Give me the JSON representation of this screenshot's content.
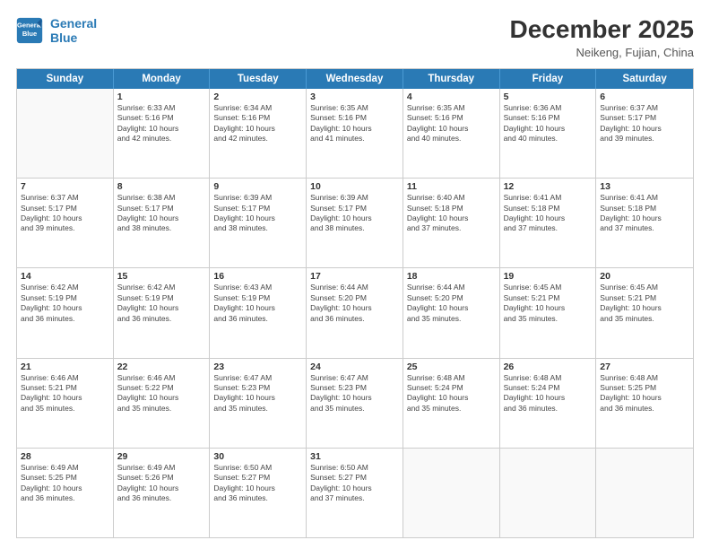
{
  "header": {
    "logo_line1": "General",
    "logo_line2": "Blue",
    "title": "December 2025",
    "subtitle": "Neikeng, Fujian, China"
  },
  "weekdays": [
    "Sunday",
    "Monday",
    "Tuesday",
    "Wednesday",
    "Thursday",
    "Friday",
    "Saturday"
  ],
  "rows": [
    [
      {
        "day": "",
        "sunrise": "",
        "sunset": "",
        "daylight": "",
        "daylight2": ""
      },
      {
        "day": "1",
        "sunrise": "Sunrise: 6:33 AM",
        "sunset": "Sunset: 5:16 PM",
        "daylight": "Daylight: 10 hours",
        "daylight2": "and 42 minutes."
      },
      {
        "day": "2",
        "sunrise": "Sunrise: 6:34 AM",
        "sunset": "Sunset: 5:16 PM",
        "daylight": "Daylight: 10 hours",
        "daylight2": "and 42 minutes."
      },
      {
        "day": "3",
        "sunrise": "Sunrise: 6:35 AM",
        "sunset": "Sunset: 5:16 PM",
        "daylight": "Daylight: 10 hours",
        "daylight2": "and 41 minutes."
      },
      {
        "day": "4",
        "sunrise": "Sunrise: 6:35 AM",
        "sunset": "Sunset: 5:16 PM",
        "daylight": "Daylight: 10 hours",
        "daylight2": "and 40 minutes."
      },
      {
        "day": "5",
        "sunrise": "Sunrise: 6:36 AM",
        "sunset": "Sunset: 5:16 PM",
        "daylight": "Daylight: 10 hours",
        "daylight2": "and 40 minutes."
      },
      {
        "day": "6",
        "sunrise": "Sunrise: 6:37 AM",
        "sunset": "Sunset: 5:17 PM",
        "daylight": "Daylight: 10 hours",
        "daylight2": "and 39 minutes."
      }
    ],
    [
      {
        "day": "7",
        "sunrise": "Sunrise: 6:37 AM",
        "sunset": "Sunset: 5:17 PM",
        "daylight": "Daylight: 10 hours",
        "daylight2": "and 39 minutes."
      },
      {
        "day": "8",
        "sunrise": "Sunrise: 6:38 AM",
        "sunset": "Sunset: 5:17 PM",
        "daylight": "Daylight: 10 hours",
        "daylight2": "and 38 minutes."
      },
      {
        "day": "9",
        "sunrise": "Sunrise: 6:39 AM",
        "sunset": "Sunset: 5:17 PM",
        "daylight": "Daylight: 10 hours",
        "daylight2": "and 38 minutes."
      },
      {
        "day": "10",
        "sunrise": "Sunrise: 6:39 AM",
        "sunset": "Sunset: 5:17 PM",
        "daylight": "Daylight: 10 hours",
        "daylight2": "and 38 minutes."
      },
      {
        "day": "11",
        "sunrise": "Sunrise: 6:40 AM",
        "sunset": "Sunset: 5:18 PM",
        "daylight": "Daylight: 10 hours",
        "daylight2": "and 37 minutes."
      },
      {
        "day": "12",
        "sunrise": "Sunrise: 6:41 AM",
        "sunset": "Sunset: 5:18 PM",
        "daylight": "Daylight: 10 hours",
        "daylight2": "and 37 minutes."
      },
      {
        "day": "13",
        "sunrise": "Sunrise: 6:41 AM",
        "sunset": "Sunset: 5:18 PM",
        "daylight": "Daylight: 10 hours",
        "daylight2": "and 37 minutes."
      }
    ],
    [
      {
        "day": "14",
        "sunrise": "Sunrise: 6:42 AM",
        "sunset": "Sunset: 5:19 PM",
        "daylight": "Daylight: 10 hours",
        "daylight2": "and 36 minutes."
      },
      {
        "day": "15",
        "sunrise": "Sunrise: 6:42 AM",
        "sunset": "Sunset: 5:19 PM",
        "daylight": "Daylight: 10 hours",
        "daylight2": "and 36 minutes."
      },
      {
        "day": "16",
        "sunrise": "Sunrise: 6:43 AM",
        "sunset": "Sunset: 5:19 PM",
        "daylight": "Daylight: 10 hours",
        "daylight2": "and 36 minutes."
      },
      {
        "day": "17",
        "sunrise": "Sunrise: 6:44 AM",
        "sunset": "Sunset: 5:20 PM",
        "daylight": "Daylight: 10 hours",
        "daylight2": "and 36 minutes."
      },
      {
        "day": "18",
        "sunrise": "Sunrise: 6:44 AM",
        "sunset": "Sunset: 5:20 PM",
        "daylight": "Daylight: 10 hours",
        "daylight2": "and 35 minutes."
      },
      {
        "day": "19",
        "sunrise": "Sunrise: 6:45 AM",
        "sunset": "Sunset: 5:21 PM",
        "daylight": "Daylight: 10 hours",
        "daylight2": "and 35 minutes."
      },
      {
        "day": "20",
        "sunrise": "Sunrise: 6:45 AM",
        "sunset": "Sunset: 5:21 PM",
        "daylight": "Daylight: 10 hours",
        "daylight2": "and 35 minutes."
      }
    ],
    [
      {
        "day": "21",
        "sunrise": "Sunrise: 6:46 AM",
        "sunset": "Sunset: 5:21 PM",
        "daylight": "Daylight: 10 hours",
        "daylight2": "and 35 minutes."
      },
      {
        "day": "22",
        "sunrise": "Sunrise: 6:46 AM",
        "sunset": "Sunset: 5:22 PM",
        "daylight": "Daylight: 10 hours",
        "daylight2": "and 35 minutes."
      },
      {
        "day": "23",
        "sunrise": "Sunrise: 6:47 AM",
        "sunset": "Sunset: 5:23 PM",
        "daylight": "Daylight: 10 hours",
        "daylight2": "and 35 minutes."
      },
      {
        "day": "24",
        "sunrise": "Sunrise: 6:47 AM",
        "sunset": "Sunset: 5:23 PM",
        "daylight": "Daylight: 10 hours",
        "daylight2": "and 35 minutes."
      },
      {
        "day": "25",
        "sunrise": "Sunrise: 6:48 AM",
        "sunset": "Sunset: 5:24 PM",
        "daylight": "Daylight: 10 hours",
        "daylight2": "and 35 minutes."
      },
      {
        "day": "26",
        "sunrise": "Sunrise: 6:48 AM",
        "sunset": "Sunset: 5:24 PM",
        "daylight": "Daylight: 10 hours",
        "daylight2": "and 36 minutes."
      },
      {
        "day": "27",
        "sunrise": "Sunrise: 6:48 AM",
        "sunset": "Sunset: 5:25 PM",
        "daylight": "Daylight: 10 hours",
        "daylight2": "and 36 minutes."
      }
    ],
    [
      {
        "day": "28",
        "sunrise": "Sunrise: 6:49 AM",
        "sunset": "Sunset: 5:25 PM",
        "daylight": "Daylight: 10 hours",
        "daylight2": "and 36 minutes."
      },
      {
        "day": "29",
        "sunrise": "Sunrise: 6:49 AM",
        "sunset": "Sunset: 5:26 PM",
        "daylight": "Daylight: 10 hours",
        "daylight2": "and 36 minutes."
      },
      {
        "day": "30",
        "sunrise": "Sunrise: 6:50 AM",
        "sunset": "Sunset: 5:27 PM",
        "daylight": "Daylight: 10 hours",
        "daylight2": "and 36 minutes."
      },
      {
        "day": "31",
        "sunrise": "Sunrise: 6:50 AM",
        "sunset": "Sunset: 5:27 PM",
        "daylight": "Daylight: 10 hours",
        "daylight2": "and 37 minutes."
      },
      {
        "day": "",
        "sunrise": "",
        "sunset": "",
        "daylight": "",
        "daylight2": ""
      },
      {
        "day": "",
        "sunrise": "",
        "sunset": "",
        "daylight": "",
        "daylight2": ""
      },
      {
        "day": "",
        "sunrise": "",
        "sunset": "",
        "daylight": "",
        "daylight2": ""
      }
    ]
  ]
}
